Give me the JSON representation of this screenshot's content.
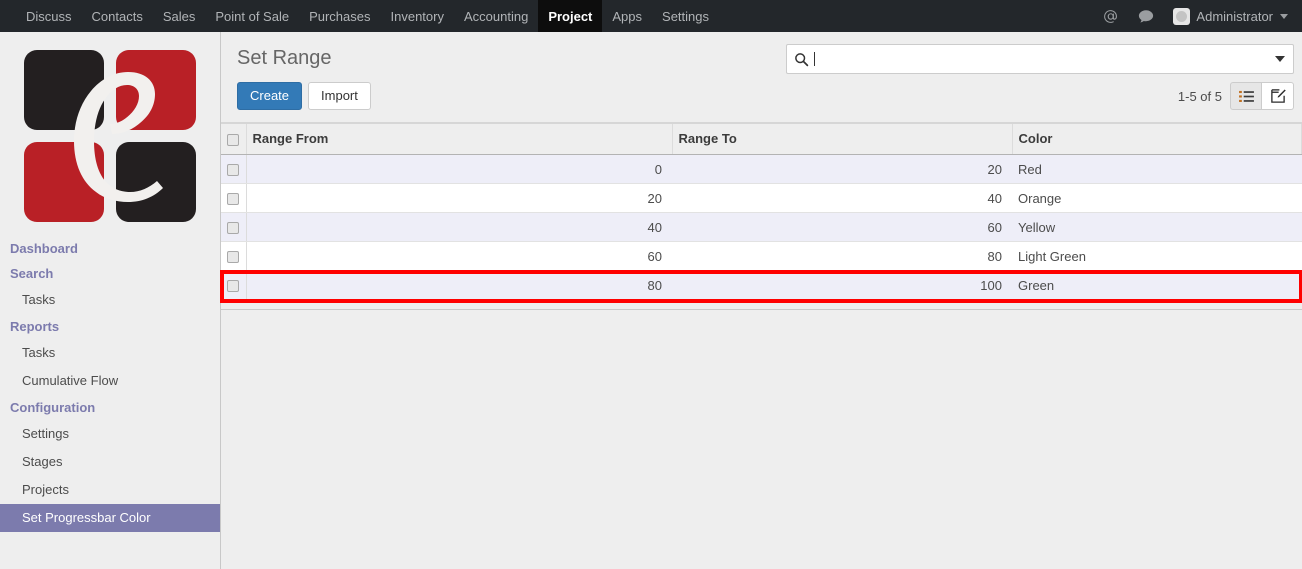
{
  "topnav": {
    "items": [
      {
        "label": "Discuss",
        "active": false
      },
      {
        "label": "Contacts",
        "active": false
      },
      {
        "label": "Sales",
        "active": false
      },
      {
        "label": "Point of Sale",
        "active": false
      },
      {
        "label": "Purchases",
        "active": false
      },
      {
        "label": "Inventory",
        "active": false
      },
      {
        "label": "Accounting",
        "active": false
      },
      {
        "label": "Project",
        "active": true
      },
      {
        "label": "Apps",
        "active": false
      },
      {
        "label": "Settings",
        "active": false
      }
    ],
    "mention_icon": "at-sign-icon",
    "messages_icon": "chat-bubble-icon",
    "user": "Administrator"
  },
  "sidebar": {
    "logo_alt": "company-logo",
    "groups": [
      {
        "title": "Dashboard",
        "items": []
      },
      {
        "title": "Search",
        "items": [
          {
            "label": "Tasks",
            "active": false
          }
        ]
      },
      {
        "title": "Reports",
        "items": [
          {
            "label": "Tasks",
            "active": false
          },
          {
            "label": "Cumulative Flow",
            "active": false
          }
        ]
      },
      {
        "title": "Configuration",
        "items": [
          {
            "label": "Settings",
            "active": false
          },
          {
            "label": "Stages",
            "active": false
          },
          {
            "label": "Projects",
            "active": false
          },
          {
            "label": "Set Progressbar Color",
            "active": true
          }
        ]
      }
    ]
  },
  "controlpanel": {
    "title": "Set Range",
    "create_label": "Create",
    "import_label": "Import",
    "search_placeholder": "",
    "search_value": "",
    "search_icon": "magnifier-icon",
    "search_dropdown_icon": "caret-down-icon",
    "pager": "1-5 of 5",
    "view_list_icon": "list-view-icon",
    "view_form_icon": "form-view-icon"
  },
  "table": {
    "columns": [
      "Range From",
      "Range To",
      "Color"
    ],
    "rows": [
      {
        "range_from": "0",
        "range_to": "20",
        "color": "Red",
        "highlighted": false
      },
      {
        "range_from": "20",
        "range_to": "40",
        "color": "Orange",
        "highlighted": false
      },
      {
        "range_from": "40",
        "range_to": "60",
        "color": "Yellow",
        "highlighted": false
      },
      {
        "range_from": "60",
        "range_to": "80",
        "color": "Light Green",
        "highlighted": false
      },
      {
        "range_from": "80",
        "range_to": "100",
        "color": "Green",
        "highlighted": true
      }
    ]
  },
  "colors": {
    "accent_purple": "#7c7bad",
    "primary_blue": "#337ab7",
    "highlight_red": "#ff0000",
    "logo_red": "#b92026",
    "logo_black": "#231f20",
    "navbar_dark": "#23272b"
  }
}
